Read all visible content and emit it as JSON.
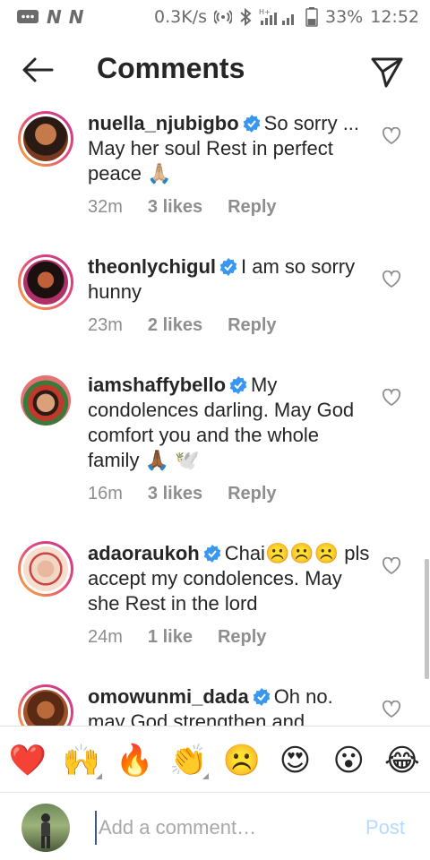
{
  "status_bar": {
    "carrier_1": "N",
    "carrier_2": "N",
    "speed": "0.3K/s",
    "network": "H+",
    "battery": "33%",
    "time": "12:52"
  },
  "header": {
    "title": "Comments"
  },
  "comments": [
    {
      "username": "nuella_njubigbo",
      "text": "So sorry ... May her soul Rest in perfect peace 🙏🏼",
      "time": "32m",
      "likes": "3 likes",
      "reply": "Reply",
      "avatar_color": "#8a4a2a"
    },
    {
      "username": "theonlychigul",
      "text": "I am so sorry hunny",
      "time": "23m",
      "likes": "2 likes",
      "reply": "Reply",
      "avatar_color": "#b0306a"
    },
    {
      "username": "iamshaffybello",
      "text": "My condolences darling. May God comfort you and the whole family 🙏🏾 🕊️",
      "time": "16m",
      "likes": "3 likes",
      "reply": "Reply",
      "avatar_color": "#c0392b"
    },
    {
      "username": "adaoraukoh",
      "text": "Chai☹️☹️☹️ pls accept my condolences. May she Rest in the lord",
      "time": "24m",
      "likes": "1 like",
      "reply": "Reply",
      "avatar_color": "#d98c7a"
    },
    {
      "username": "omowunmi_dada",
      "text": "Oh no. may God strengthen and",
      "time": "",
      "likes": "",
      "reply": "",
      "avatar_color": "#a0522d"
    }
  ],
  "emoji_bar": [
    "❤️",
    "🙌",
    "🔥",
    "👏",
    "☹️",
    "😍",
    "😮",
    "😂"
  ],
  "composer": {
    "placeholder": "Add a comment…",
    "post_label": "Post"
  },
  "colors": {
    "verified_blue": "#3897f0",
    "meta_gray": "#8e8e8e",
    "post_disabled": "#b3dbff"
  }
}
